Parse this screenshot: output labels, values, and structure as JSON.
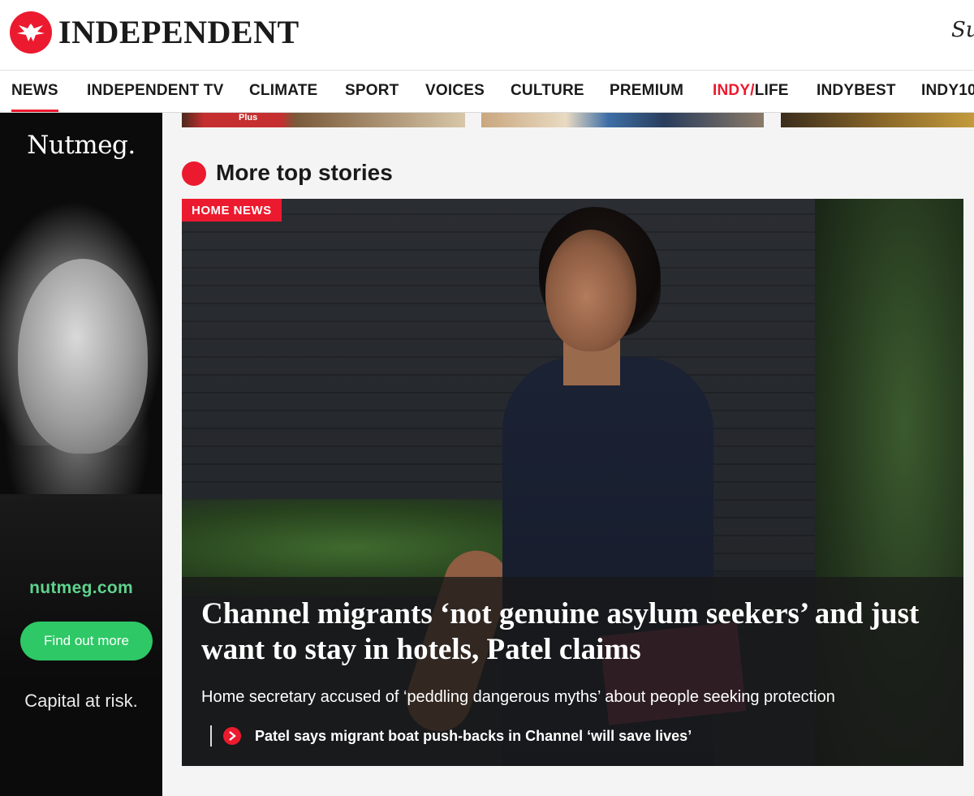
{
  "header": {
    "logo_text": "INDEPENDENT",
    "subscribe_partial": "Su"
  },
  "nav": {
    "items": [
      {
        "label": "NEWS",
        "active": true
      },
      {
        "label": "INDEPENDENT TV"
      },
      {
        "label": "CLIMATE"
      },
      {
        "label": "SPORT"
      },
      {
        "label": "VOICES"
      },
      {
        "label": "CULTURE"
      },
      {
        "label": "PREMIUM"
      },
      {
        "label_prefix": "INDY/",
        "label_suffix": "LIFE"
      },
      {
        "label": "INDYBEST"
      },
      {
        "label": "INDY10"
      }
    ]
  },
  "ad": {
    "brand": "Nutmeg.",
    "url": "nutmeg.com",
    "cta": "Find out more",
    "disclaimer": "Capital at risk."
  },
  "top_strip": {
    "thumb1_tag": "Plus"
  },
  "section": {
    "title": "More top stories"
  },
  "lead_story": {
    "category": "HOME NEWS",
    "headline": "Channel migrants ‘not genuine asylum seekers’ and just want to stay in hotels, Patel claims",
    "standfirst": "Home secretary accused of ‘peddling dangerous myths’ about people seeking protection",
    "related_link": "Patel says migrant boat push-backs in Channel ‘will save lives’"
  },
  "colors": {
    "brand_red": "#ec1a2e",
    "ad_green": "#2ec866",
    "ad_url_green": "#5fd38d"
  },
  "icons": {
    "logo": "eagle-icon",
    "related": "chevron-right-icon"
  }
}
